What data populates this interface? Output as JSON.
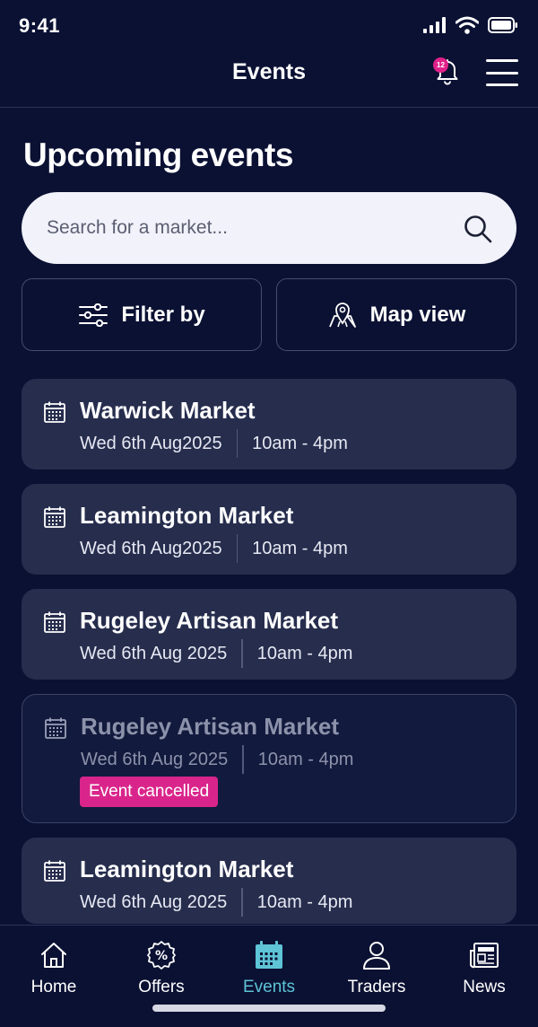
{
  "status_bar": {
    "time": "9:41"
  },
  "header": {
    "title": "Events",
    "notification_count": "12"
  },
  "page_title": "Upcoming events",
  "search": {
    "placeholder": "Search for a market..."
  },
  "filters": {
    "filter_label": "Filter by",
    "map_label": "Map view"
  },
  "events": [
    {
      "name": "Warwick Market",
      "date": "Wed 6th Aug2025",
      "time": "10am - 4pm"
    },
    {
      "name": "Leamington Market",
      "date": "Wed 6th Aug2025",
      "time": "10am - 4pm"
    },
    {
      "name": "Rugeley Artisan Market",
      "date": "Wed 6th Aug 2025",
      "time": "10am - 4pm"
    },
    {
      "name": "Rugeley Artisan Market",
      "date": "Wed 6th Aug 2025",
      "time": "10am - 4pm",
      "status": "Event cancelled"
    },
    {
      "name": "Leamington Market",
      "date": "Wed 6th Aug 2025",
      "time": "10am - 4pm"
    }
  ],
  "nav": [
    {
      "label": "Home",
      "icon": "home-icon"
    },
    {
      "label": "Offers",
      "icon": "offers-icon"
    },
    {
      "label": "Events",
      "icon": "calendar-icon",
      "active": true
    },
    {
      "label": "Traders",
      "icon": "user-icon"
    },
    {
      "label": "News",
      "icon": "newspaper-icon"
    }
  ],
  "colors": {
    "background": "#0b1133",
    "card": "#262d4d",
    "accent": "#5ec4d6",
    "badge": "#d9258b"
  }
}
